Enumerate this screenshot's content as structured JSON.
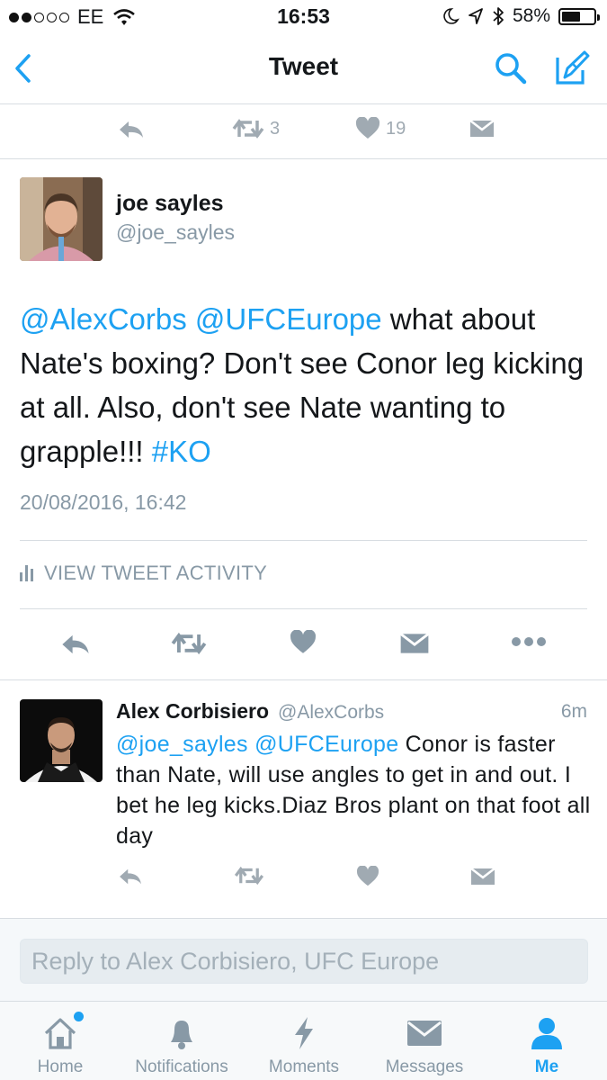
{
  "status_bar": {
    "carrier": "EE",
    "time": "16:53",
    "battery": "58%",
    "battery_level": 0.58
  },
  "nav": {
    "title": "Tweet"
  },
  "prev_tweet_actions": {
    "retweets": "3",
    "likes": "19"
  },
  "tweet": {
    "author_name": "joe sayles",
    "author_handle": "@joe_sayles",
    "mention1": "@AlexCorbs",
    "mention2": "@UFCEurope",
    "text_body": " what about Nate's boxing? Don't see Conor leg kicking at all. Also, don't see Nate wanting to grapple!!! ",
    "hashtag": "#KO",
    "timestamp": "20/08/2016, 16:42",
    "activity_label": "VIEW TWEET ACTIVITY"
  },
  "reply": {
    "author_name": "Alex Corbisiero",
    "author_handle": "@AlexCorbs",
    "age": "6m",
    "mention1": "@joe_sayles",
    "mention2": "@UFCEurope",
    "text_body": " Conor is faster than Nate, will use angles to get in and out. I bet he leg kicks.Diaz Bros plant on that foot all day"
  },
  "composer": {
    "placeholder": "Reply to Alex Corbisiero, UFC Europe"
  },
  "tabs": [
    {
      "label": "Home"
    },
    {
      "label": "Notifications"
    },
    {
      "label": "Moments"
    },
    {
      "label": "Messages"
    },
    {
      "label": "Me"
    }
  ],
  "colors": {
    "accent": "#1da1f2",
    "muted": "#8899a6",
    "icon_gray": "#a0aab2"
  }
}
